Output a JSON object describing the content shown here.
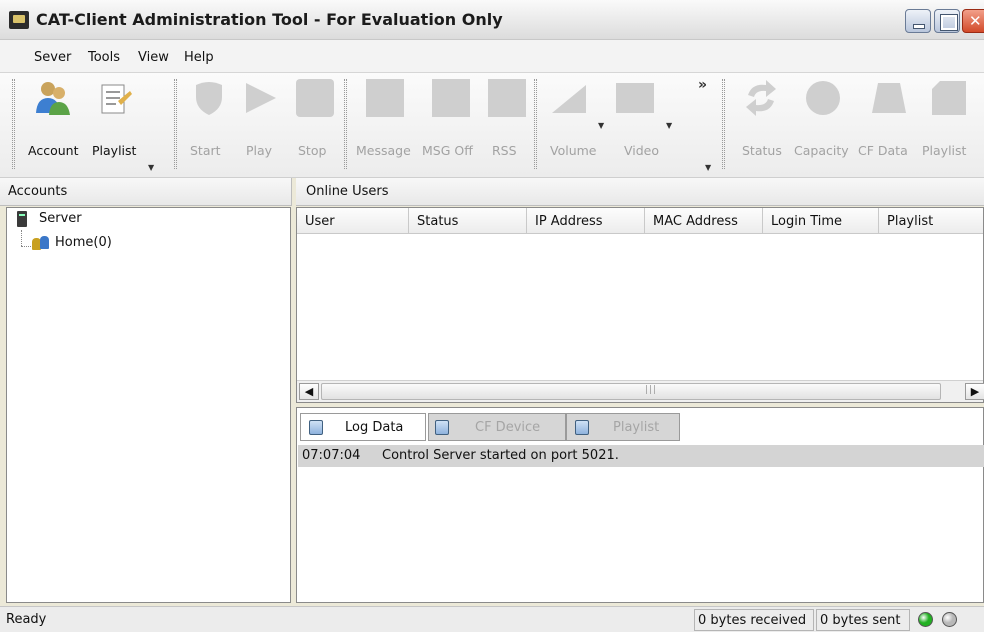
{
  "window": {
    "title": "CAT-Client Administration Tool - For Evaluation Only"
  },
  "menu": [
    "Sever",
    "Tools",
    "View",
    "Help"
  ],
  "toolbar": {
    "groups": [
      [
        {
          "label": "Account",
          "enabled": true,
          "icon": "users-icon"
        },
        {
          "label": "Playlist",
          "enabled": true,
          "icon": "playlist-icon"
        }
      ],
      [
        {
          "label": "Start",
          "enabled": false,
          "icon": "shield-icon"
        },
        {
          "label": "Play",
          "enabled": false,
          "icon": "play-icon"
        },
        {
          "label": "Stop",
          "enabled": false,
          "icon": "stop-icon"
        }
      ],
      [
        {
          "label": "Message",
          "enabled": false,
          "icon": "message-icon"
        },
        {
          "label": "MSG Off",
          "enabled": false,
          "icon": "message-off-icon"
        },
        {
          "label": "RSS",
          "enabled": false,
          "icon": "rss-icon"
        }
      ],
      [
        {
          "label": "Volume",
          "enabled": false,
          "icon": "volume-icon"
        },
        {
          "label": "Video",
          "enabled": false,
          "icon": "video-icon"
        }
      ],
      [
        {
          "label": "Status",
          "enabled": false,
          "icon": "refresh-icon"
        },
        {
          "label": "Capacity",
          "enabled": false,
          "icon": "capacity-icon"
        },
        {
          "label": "CF Data",
          "enabled": false,
          "icon": "cf-card-icon"
        },
        {
          "label": "Playlist",
          "enabled": false,
          "icon": "playlist-icon"
        }
      ]
    ],
    "overflow": "»"
  },
  "accounts": {
    "title": "Accounts",
    "tree": {
      "root": "Server",
      "child": "Home(0)"
    }
  },
  "online_users": {
    "title": "Online Users",
    "columns": [
      "User",
      "Status",
      "IP Address",
      "MAC Address",
      "Login Time",
      "Playlist"
    ]
  },
  "log": {
    "tabs": [
      {
        "label": "Log Data",
        "active": true
      },
      {
        "label": "CF Device",
        "active": false
      },
      {
        "label": "Playlist",
        "active": false
      }
    ],
    "entries": [
      {
        "time": "07:07:04",
        "message": "Control Server started on port 5021."
      }
    ]
  },
  "status": {
    "ready": "Ready",
    "received": "0 bytes received",
    "sent": "0 bytes sent",
    "led_colors": [
      "#22b022",
      "#b8b8b8"
    ]
  }
}
